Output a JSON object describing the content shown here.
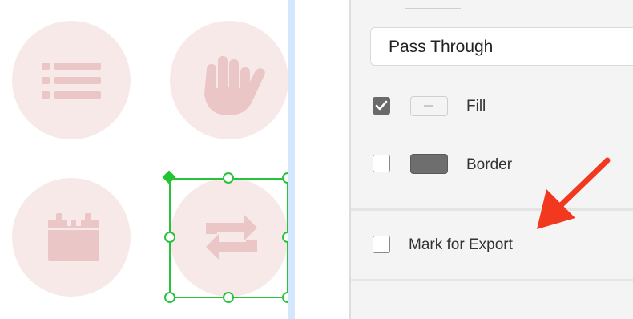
{
  "blend_mode": {
    "value": "Pass Through"
  },
  "fill": {
    "label": "Fill",
    "checked": true
  },
  "border": {
    "label": "Border",
    "checked": false
  },
  "export": {
    "label": "Mark for Export",
    "checked": false
  },
  "icons": [
    "list-icon",
    "hand-icon",
    "calendar-icon",
    "repeat-icon"
  ],
  "colors": {
    "icon_circle": "#f8e9e9",
    "icon_glyph": "#ebc6c6",
    "selection": "#29c23d",
    "annotation_arrow": "#f2381f",
    "guide": "#d3e9fb"
  }
}
